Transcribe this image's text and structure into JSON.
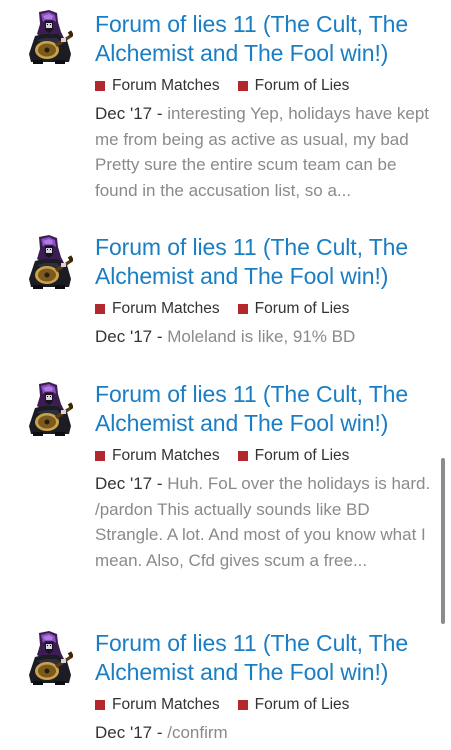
{
  "colors": {
    "link": "#1a7ec4",
    "category_square": "#b3282d"
  },
  "results": [
    {
      "title_line1": "Forum of lies 11 (The Cult, The",
      "title_line2": "Alchemist and The Fool win!)",
      "category1": "Forum Matches",
      "category2": "Forum of Lies",
      "date": "Dec '17",
      "separator": " - ",
      "excerpt": "interesting Yep, holidays have kept me from being as active as usual, my bad Pretty sure the entire scum team can be found in the accusation list, so a..."
    },
    {
      "title_line1": "Forum of lies 11 (The Cult, The",
      "title_line2": "Alchemist and The Fool win!)",
      "category1": "Forum Matches",
      "category2": "Forum of Lies",
      "date": "Dec '17",
      "separator": " - ",
      "excerpt": "Moleland is like, 91% BD"
    },
    {
      "title_line1": "Forum of lies 11 (The Cult, The",
      "title_line2": "Alchemist and The Fool win!)",
      "category1": "Forum Matches",
      "category2": "Forum of Lies",
      "date": "Dec '17",
      "separator": " - ",
      "excerpt": "Huh. FoL over the holidays is hard. /pardon This actually sounds like BD Strangle. A lot. And most of you know what I mean. Also, Cfd gives scum a free..."
    },
    {
      "title_line1": "Forum of lies 11 (The Cult, The",
      "title_line2": "Alchemist and The Fool win!)",
      "category1": "Forum Matches",
      "category2": "Forum of Lies",
      "date": "Dec '17",
      "separator": " - ",
      "excerpt": "/confirm"
    }
  ]
}
